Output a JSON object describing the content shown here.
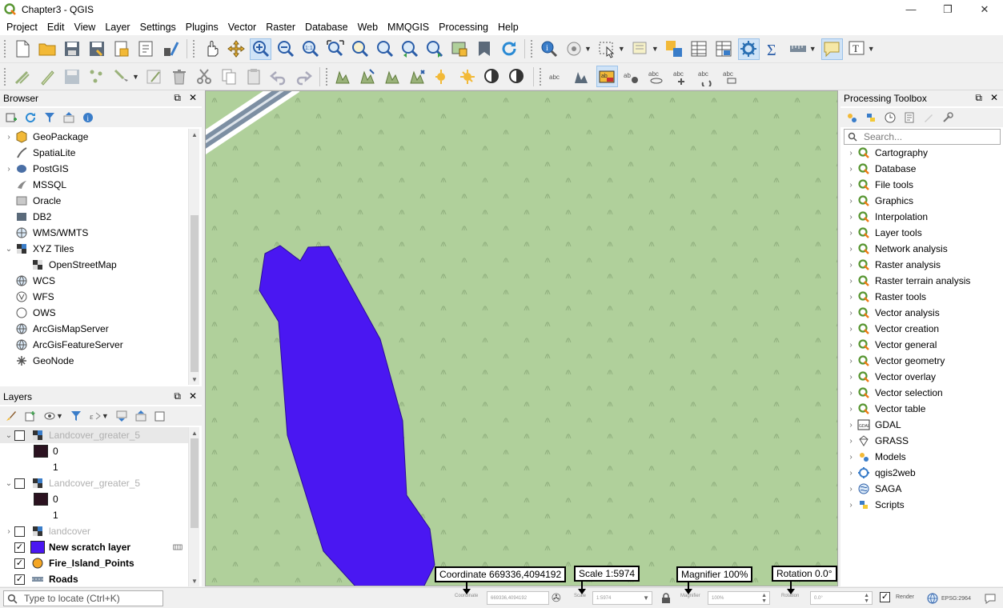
{
  "window": {
    "title": "Chapter3 - QGIS",
    "controls": [
      "—",
      "❐",
      "✕"
    ]
  },
  "menu": [
    "Project",
    "Edit",
    "View",
    "Layer",
    "Settings",
    "Plugins",
    "Vector",
    "Raster",
    "Database",
    "Web",
    "MMQGIS",
    "Processing",
    "Help"
  ],
  "browser": {
    "title": "Browser",
    "items": [
      {
        "label": "GeoPackage",
        "icon": "geopackage-icon",
        "expandable": true
      },
      {
        "label": "SpatiaLite",
        "icon": "spatialite-icon",
        "expandable": false
      },
      {
        "label": "PostGIS",
        "icon": "postgis-icon",
        "expandable": true
      },
      {
        "label": "MSSQL",
        "icon": "mssql-icon",
        "expandable": false
      },
      {
        "label": "Oracle",
        "icon": "oracle-icon",
        "expandable": false
      },
      {
        "label": "DB2",
        "icon": "db2-icon",
        "expandable": false
      },
      {
        "label": "WMS/WMTS",
        "icon": "wms-icon",
        "expandable": false
      },
      {
        "label": "XYZ Tiles",
        "icon": "xyz-tiles-icon",
        "expandable": true,
        "expanded": true
      },
      {
        "label": "OpenStreetMap",
        "icon": "tile-layer-icon",
        "child": true
      },
      {
        "label": "WCS",
        "icon": "wcs-icon",
        "expandable": false
      },
      {
        "label": "WFS",
        "icon": "wfs-icon",
        "expandable": false
      },
      {
        "label": "OWS",
        "icon": "ows-icon",
        "expandable": false
      },
      {
        "label": "ArcGisMapServer",
        "icon": "arcgis-map-icon",
        "expandable": false
      },
      {
        "label": "ArcGisFeatureServer",
        "icon": "arcgis-feature-icon",
        "expandable": false
      },
      {
        "label": "GeoNode",
        "icon": "geonode-icon",
        "expandable": false
      }
    ]
  },
  "layers": {
    "title": "Layers",
    "items": [
      {
        "label": "Landcover_greater_5",
        "type": "raster",
        "checked": false,
        "dim": true,
        "selected": true,
        "expanded": true
      },
      {
        "label": "0",
        "type": "legend",
        "color": "#2b1220"
      },
      {
        "label": "1",
        "type": "legend",
        "color": "#ffffff"
      },
      {
        "label": "Landcover_greater_5",
        "type": "raster",
        "checked": false,
        "dim": true,
        "expanded": true
      },
      {
        "label": "0",
        "type": "legend",
        "color": "#2b1220"
      },
      {
        "label": "1",
        "type": "legend",
        "color": "#ffffff"
      },
      {
        "label": "landcover",
        "type": "raster",
        "checked": false,
        "dim": true,
        "expanded": false
      },
      {
        "label": "New scratch layer",
        "type": "polygon",
        "checked": true,
        "bold": true,
        "color": "#4a17f2"
      },
      {
        "label": "Fire_Island_Points",
        "type": "point",
        "checked": true,
        "bold": true,
        "color": "#f5a623"
      },
      {
        "label": "Roads",
        "type": "line",
        "checked": true,
        "bold": true,
        "color": "#7d8fa3"
      }
    ]
  },
  "toolbox": {
    "title": "Processing Toolbox",
    "search_placeholder": "Search...",
    "groups": [
      {
        "label": "Cartography",
        "icon": "qgis-icon"
      },
      {
        "label": "Database",
        "icon": "qgis-icon"
      },
      {
        "label": "File tools",
        "icon": "qgis-icon"
      },
      {
        "label": "Graphics",
        "icon": "qgis-icon"
      },
      {
        "label": "Interpolation",
        "icon": "qgis-icon"
      },
      {
        "label": "Layer tools",
        "icon": "qgis-icon"
      },
      {
        "label": "Network analysis",
        "icon": "qgis-icon"
      },
      {
        "label": "Raster analysis",
        "icon": "qgis-icon"
      },
      {
        "label": "Raster terrain analysis",
        "icon": "qgis-icon"
      },
      {
        "label": "Raster tools",
        "icon": "qgis-icon"
      },
      {
        "label": "Vector analysis",
        "icon": "qgis-icon"
      },
      {
        "label": "Vector creation",
        "icon": "qgis-icon"
      },
      {
        "label": "Vector general",
        "icon": "qgis-icon"
      },
      {
        "label": "Vector geometry",
        "icon": "qgis-icon"
      },
      {
        "label": "Vector overlay",
        "icon": "qgis-icon"
      },
      {
        "label": "Vector selection",
        "icon": "qgis-icon"
      },
      {
        "label": "Vector table",
        "icon": "qgis-icon"
      },
      {
        "label": "GDAL",
        "icon": "gdal-icon"
      },
      {
        "label": "GRASS",
        "icon": "grass-icon"
      },
      {
        "label": "Models",
        "icon": "models-icon"
      },
      {
        "label": "qgis2web",
        "icon": "qgis2web-icon"
      },
      {
        "label": "SAGA",
        "icon": "saga-icon"
      },
      {
        "label": "Scripts",
        "icon": "python-icon"
      }
    ]
  },
  "statusbar": {
    "locate_placeholder": "Type to locate (Ctrl+K)",
    "coordinate_label": "Coordinate",
    "coordinate_value": "669336,4094192",
    "scale_label": "Scale",
    "scale_value": "1:5974",
    "magnifier_label": "Magnifier",
    "magnifier_value": "100%",
    "rotation_label": "Rotation",
    "rotation_value": "0.0°",
    "render_label": "Render",
    "crs": "EPSG:2964"
  },
  "callouts": {
    "coordinate": "Coordinate 669336,4094192",
    "scale": "Scale 1:5974",
    "magnifier": "Magnifier 100%",
    "rotation": "Rotation 0.0°"
  },
  "colors": {
    "map_background": "#b0d09b",
    "scratch_polygon": "#4a17f2",
    "road": "#7d8fa3"
  }
}
